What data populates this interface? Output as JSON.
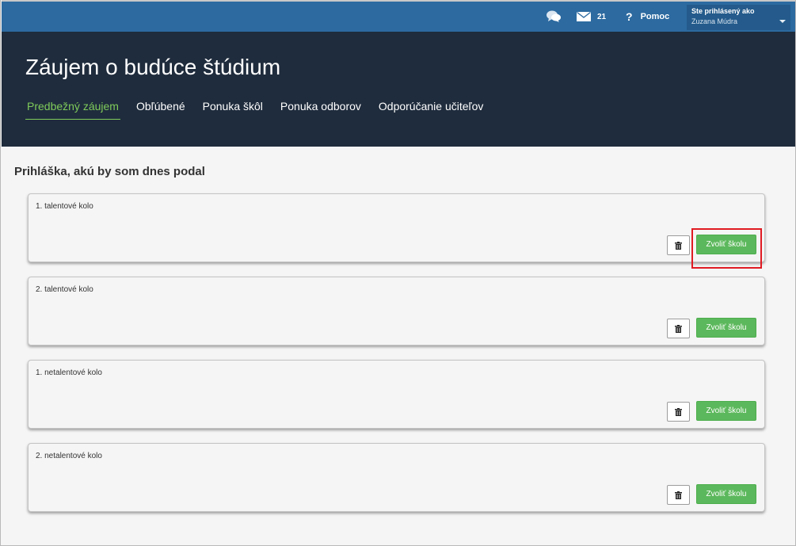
{
  "topbar": {
    "chat_icon": "chat-icon",
    "mail_icon": "mail-icon",
    "mail_count": "21",
    "help_icon": "?",
    "help_label": "Pomoc",
    "logged_in_label": "Ste prihlásený ako",
    "user_name": "Zuzana Múdra"
  },
  "header": {
    "title": "Záujem o budúce štúdium",
    "tabs": [
      {
        "label": "Predbežný záujem",
        "active": true
      },
      {
        "label": "Obľúbené",
        "active": false
      },
      {
        "label": "Ponuka škôl",
        "active": false
      },
      {
        "label": "Ponuka odborov",
        "active": false
      },
      {
        "label": "Odporúčanie učiteľov",
        "active": false
      }
    ]
  },
  "main": {
    "section_title": "Prihláška, akú by som dnes podal",
    "cards": [
      {
        "title": "1. talentové kolo",
        "button_label": "Zvoliť školu"
      },
      {
        "title": "2. talentové kolo",
        "button_label": "Zvoliť školu"
      },
      {
        "title": "1. netalentové kolo",
        "button_label": "Zvoliť školu"
      },
      {
        "title": "2. netalentové kolo",
        "button_label": "Zvoliť školu"
      }
    ]
  },
  "colors": {
    "topbar": "#2c6aa0",
    "hero": "#1f2c3d",
    "active_tab": "#7fcb5a",
    "button": "#5cb85c",
    "highlight": "#e01b22"
  }
}
